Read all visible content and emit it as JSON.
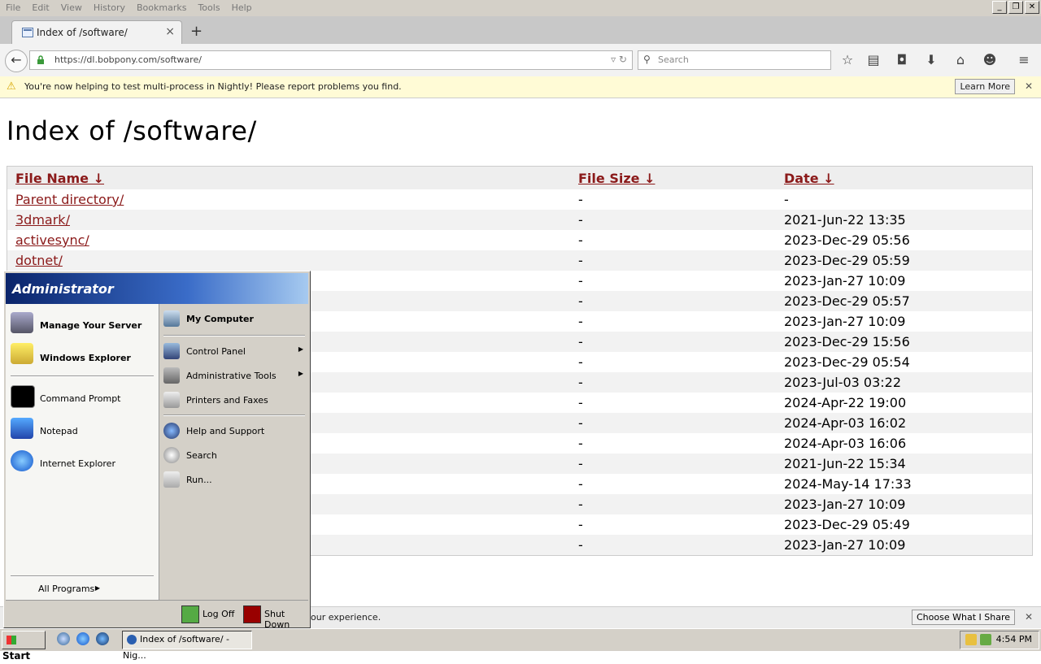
{
  "browser": {
    "menu": [
      "File",
      "Edit",
      "View",
      "History",
      "Bookmarks",
      "Tools",
      "Help"
    ],
    "tab_title": "Index of /software/",
    "url": "https://dl.bobpony.com/software/",
    "search_placeholder": "Search",
    "notification": "You're now helping to test multi-process in Nightly! Please report problems you find.",
    "learn_more": "Learn More",
    "bottom_notification": "our experience.",
    "choose_share": "Choose What I Share"
  },
  "page": {
    "title": "Index of /software/",
    "columns": [
      "File Name  ↓",
      "File Size  ↓",
      "Date  ↓"
    ],
    "rows": [
      {
        "name": "Parent directory/",
        "size": "-",
        "date": "-"
      },
      {
        "name": "3dmark/",
        "size": "-",
        "date": "2021-Jun-22 13:35"
      },
      {
        "name": "activesync/",
        "size": "-",
        "date": "2023-Dec-29 05:56"
      },
      {
        "name": "dotnet/",
        "size": "-",
        "date": "2023-Dec-29 05:59"
      },
      {
        "name": "",
        "size": "-",
        "date": "2023-Jan-27 10:09"
      },
      {
        "name": "",
        "size": "-",
        "date": "2023-Dec-29 05:57"
      },
      {
        "name": "",
        "size": "-",
        "date": "2023-Jan-27 10:09"
      },
      {
        "name": "",
        "size": "-",
        "date": "2023-Dec-29 15:56"
      },
      {
        "name": "",
        "size": "-",
        "date": "2023-Dec-29 05:54"
      },
      {
        "name": "",
        "size": "-",
        "date": "2023-Jul-03 03:22"
      },
      {
        "name": "",
        "size": "-",
        "date": "2024-Apr-22 19:00"
      },
      {
        "name": "",
        "size": "-",
        "date": "2024-Apr-03 16:02"
      },
      {
        "name": "",
        "size": "-",
        "date": "2024-Apr-03 16:06"
      },
      {
        "name": "",
        "size": "-",
        "date": "2021-Jun-22 15:34"
      },
      {
        "name": "",
        "size": "-",
        "date": "2024-May-14 17:33"
      },
      {
        "name": "",
        "size": "-",
        "date": "2023-Jan-27 10:09"
      },
      {
        "name": "",
        "size": "-",
        "date": "2023-Dec-29 05:49"
      },
      {
        "name": "",
        "size": "-",
        "date": "2023-Jan-27 10:09"
      }
    ]
  },
  "start_menu": {
    "user": "Administrator",
    "pinned": [
      "Manage Your Server",
      "Windows Explorer"
    ],
    "recent": [
      "Command Prompt",
      "Notepad",
      "Internet Explorer"
    ],
    "all_programs": "All Programs",
    "right": {
      "my_computer": "My Computer",
      "control_panel": "Control Panel",
      "admin_tools": "Administrative Tools",
      "printers": "Printers and Faxes",
      "help": "Help and Support",
      "search": "Search",
      "run": "Run..."
    },
    "log_off": "Log Off",
    "shut_down": "Shut Down"
  },
  "taskbar": {
    "start": "Start",
    "task_item": "Index of /software/ - Nig...",
    "clock": "4:54 PM"
  },
  "colors": {
    "link": "#8b1a1a",
    "start_header": "#0a246a"
  }
}
